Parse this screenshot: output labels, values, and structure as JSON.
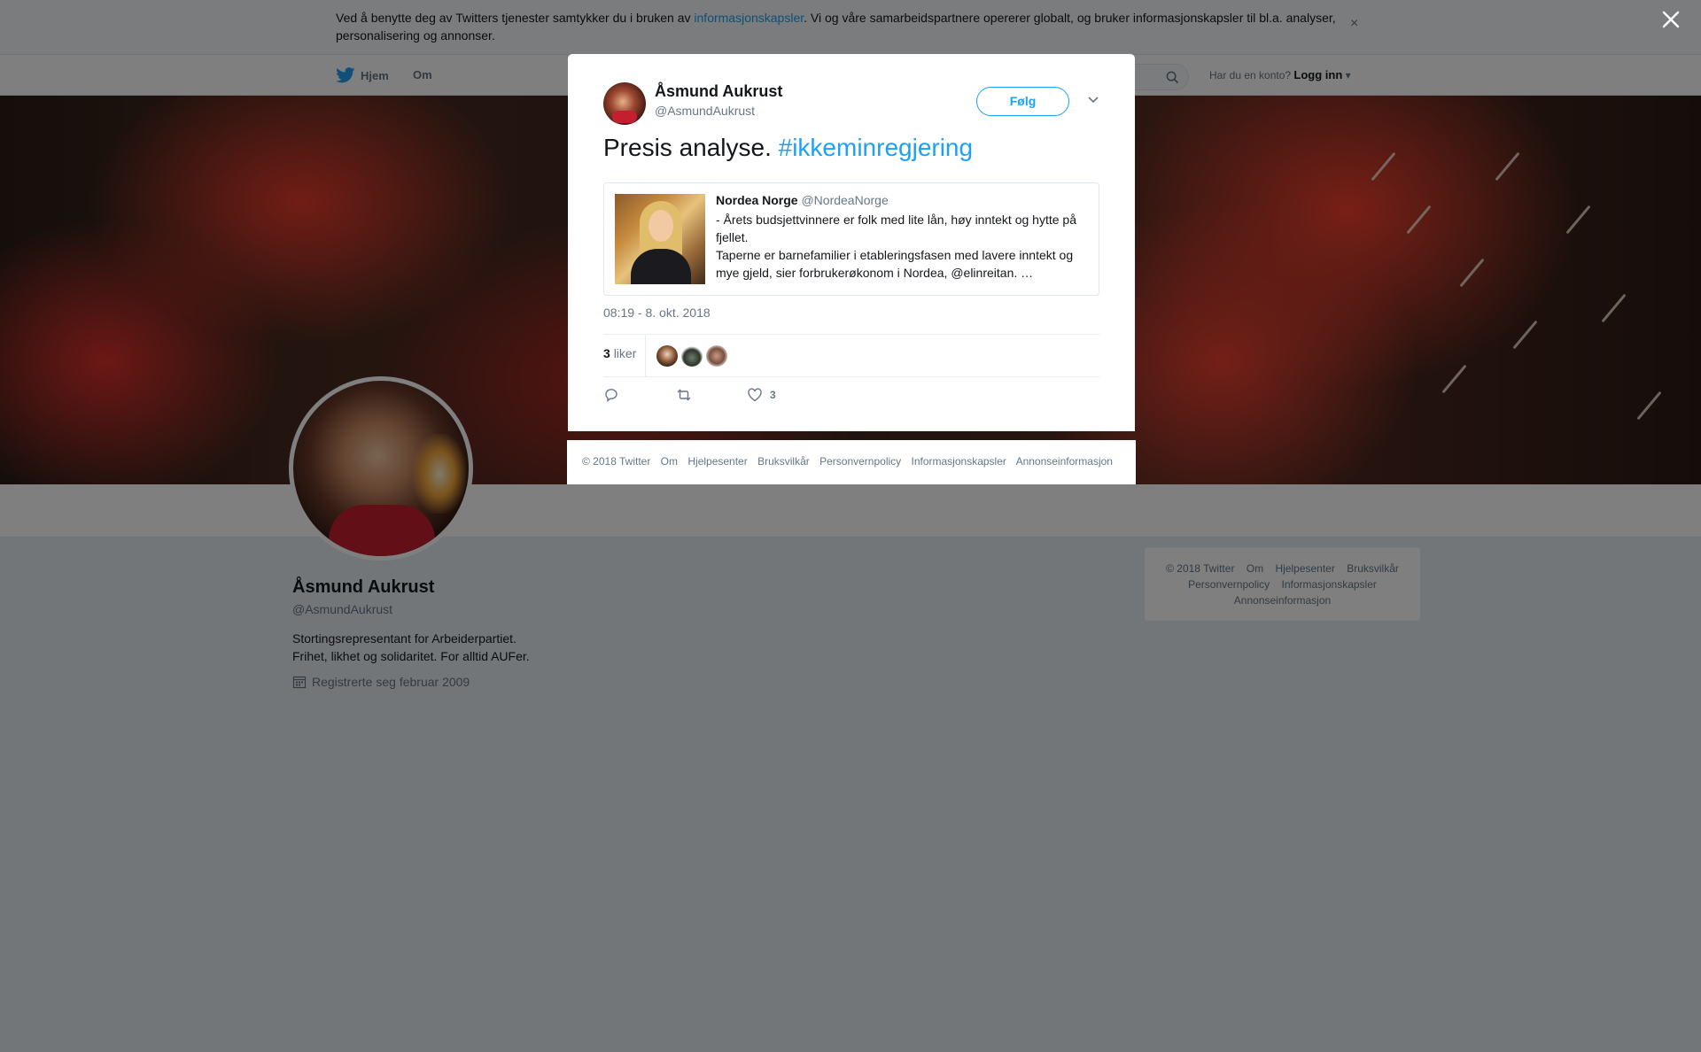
{
  "cookie_banner": {
    "text_before": "Ved å benytte deg av Twitters tjenester samtykker du i bruken av ",
    "link": "informasjonskapsler",
    "text_after": ". Vi og våre samarbeidspartnere opererer globalt, og bruker informasjonskapsler til bl.a. analyser, personalisering og annonser.",
    "close": "×"
  },
  "nav": {
    "home": "Hjem",
    "om": "Om",
    "account_question": "Har du en konto?",
    "login": "Logg inn"
  },
  "profile": {
    "name": "Åsmund Aukrust",
    "handle": "@AsmundAukrust",
    "bio_line1": "Stortingsrepresentant for Arbeiderpartiet.",
    "bio_line2": "Frihet, likhet og solidaritet. For alltid AUFer.",
    "joined": "Registrerte seg februar 2009"
  },
  "side_footer": {
    "links": [
      "© 2018 Twitter",
      "Om",
      "Hjelpesenter",
      "Bruksvilkår",
      "Personvernpolicy",
      "Informasjonskapsler",
      "Annonseinformasjon"
    ]
  },
  "tweet": {
    "author_name": "Åsmund Aukrust",
    "author_handle": "@AsmundAukrust",
    "follow": "Følg",
    "text": "Presis analyse. ",
    "hashtag": "#ikkeminregjering",
    "quoted": {
      "name": "Nordea Norge",
      "handle": "@NordeaNorge",
      "line1": "- Årets budsjettvinnere er folk med lite lån, høy inntekt og hytte på fjellet.",
      "line2": "Taperne er barnefamilier i etableringsfasen med lavere inntekt og mye gjeld, sier forbrukerøkonom i Nordea, @elinreitan. …"
    },
    "timestamp": "08:19 - 8. okt. 2018",
    "likes_count": "3",
    "likes_label": "liker",
    "like_action_count": "3"
  },
  "modal_footer": {
    "copyright": "© 2018 Twitter",
    "om": "Om",
    "help": "Hjelpesenter",
    "terms": "Bruksvilkår",
    "privacy": "Personvernpolicy",
    "cookies": "Informasjonskapsler",
    "ads": "Annonseinformasjon"
  },
  "colors": {
    "accent": "#1da1f2",
    "text": "#14171a",
    "muted": "#657786",
    "background": "#e6ecf0"
  },
  "icons": [
    "twitter-bird-icon",
    "search-icon",
    "calendar-icon",
    "close-icon",
    "chevron-down-icon",
    "reply-icon",
    "retweet-icon",
    "heart-icon"
  ]
}
